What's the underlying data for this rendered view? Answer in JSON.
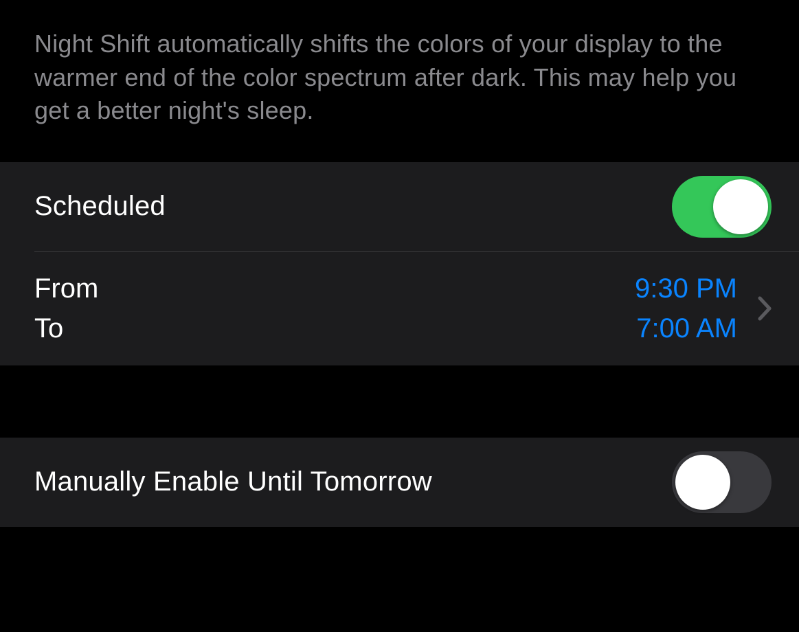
{
  "description": "Night Shift automatically shifts the colors of your display to the warmer end of the color spectrum after dark. This may help you get a better night's sleep.",
  "scheduled": {
    "label": "Scheduled",
    "enabled": true
  },
  "schedule": {
    "from_label": "From",
    "to_label": "To",
    "from_value": "9:30 PM",
    "to_value": "7:00 AM"
  },
  "manual": {
    "label": "Manually Enable Until Tomorrow",
    "enabled": false
  }
}
